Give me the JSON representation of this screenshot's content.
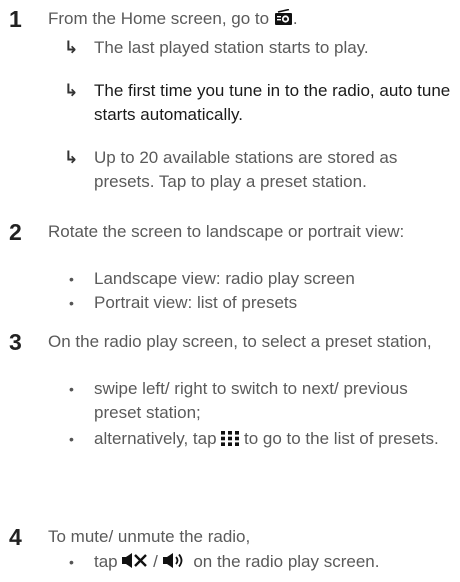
{
  "steps": [
    {
      "number": "1",
      "text_before": "From the Home screen, go to",
      "text_after": ".",
      "icon": "radio-icon",
      "results": [
        "The last played station starts to play.",
        "The first time you tune in to the radio, auto tune starts automatically.",
        "Up to 20 available stations are stored as presets. Tap to play a preset station."
      ]
    },
    {
      "number": "2",
      "text": "Rotate the screen to landscape or portrait view:",
      "bullets": [
        "Landscape view: radio play screen",
        "Portrait view: list of presets"
      ]
    },
    {
      "number": "3",
      "text": "On the radio play screen, to select a preset station,",
      "bullets": [
        "swipe left/ right to switch to next/ previous preset station;"
      ],
      "bullet2_before": "alternatively, tap",
      "bullet2_after": "to go to the list of presets.",
      "bullet2_icon": "grid-icon"
    },
    {
      "number": "4",
      "text": "To mute/ unmute the radio,",
      "bullet_before": "tap",
      "bullet_separator": "/",
      "bullet_after": "on the radio play screen.",
      "bullet_icons": [
        "mute-icon",
        "speaker-icon"
      ]
    }
  ],
  "glyphs": {
    "arrow": "↳",
    "bullet": "•"
  }
}
